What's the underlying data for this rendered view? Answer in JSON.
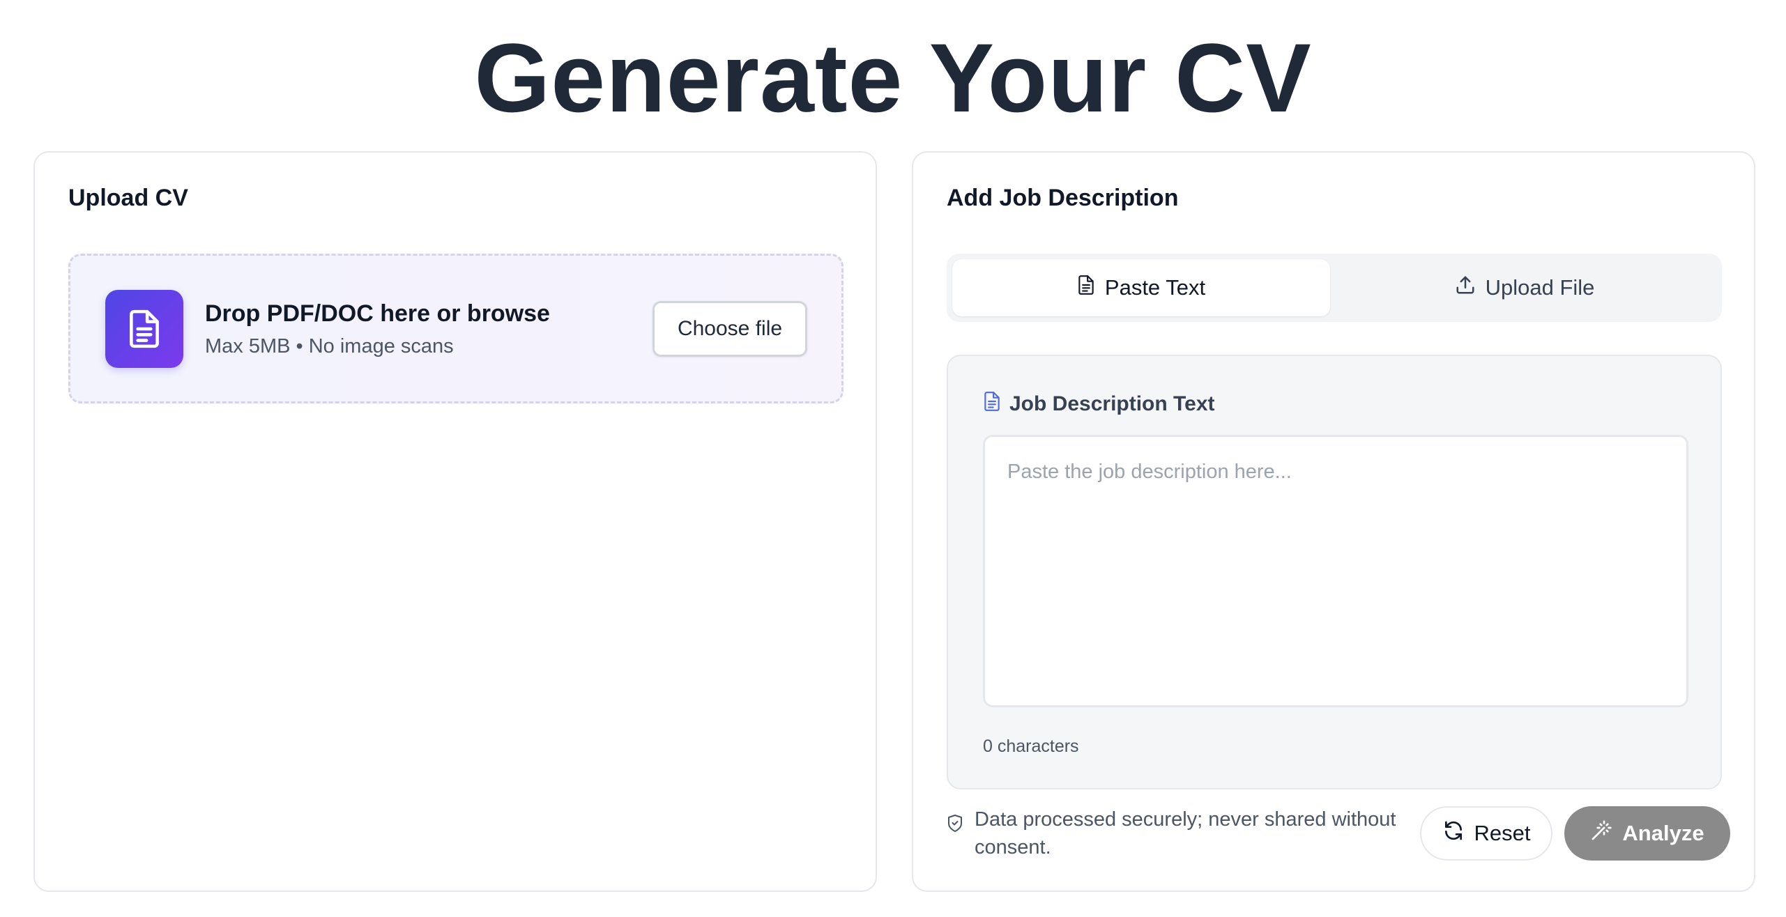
{
  "page_title": "Generate Your CV",
  "upload_card": {
    "title": "Upload CV",
    "dropzone": {
      "icon": "file-text-icon",
      "title": "Drop PDF/DOC here or browse",
      "subtitle": "Max 5MB • No image scans",
      "choose_label": "Choose file"
    }
  },
  "job_card": {
    "title": "Add Job Description",
    "tabs": [
      {
        "label": "Paste Text",
        "icon": "file-text-icon",
        "active": true
      },
      {
        "label": "Upload File",
        "icon": "upload-icon",
        "active": false
      }
    ],
    "panel": {
      "label": "Job Description Text",
      "label_icon": "file-text-icon",
      "textarea_value": "",
      "placeholder": "Paste the job description here...",
      "char_count": "0 characters"
    },
    "footer": {
      "secure_note": "Data processed securely; never shared without consent.",
      "secure_icon": "shield-icon",
      "reset_label": "Reset",
      "analyze_label": "Analyze"
    }
  },
  "colors": {
    "title": "#1f2937",
    "accent_gradient_start": "#4f46e5",
    "accent_gradient_end": "#7c3aed",
    "label_icon": "#4f6bd6",
    "analyze_disabled": "#8a8a8a"
  }
}
